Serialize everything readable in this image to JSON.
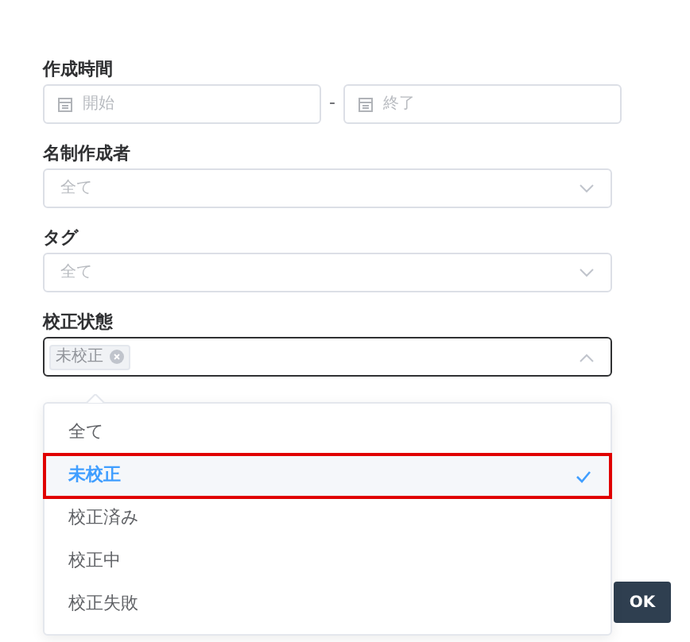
{
  "created_time": {
    "label": "作成時間",
    "start": {
      "placeholder": "開始"
    },
    "separator": "-",
    "end": {
      "placeholder": "終了"
    }
  },
  "card_creator": {
    "label": "名制作成者",
    "placeholder": "全て",
    "expanded": false
  },
  "tag": {
    "label": "タグ",
    "placeholder": "全て",
    "expanded": false
  },
  "calibration_status": {
    "label": "校正状態",
    "expanded": true,
    "chips": [
      {
        "label": "未校正"
      }
    ],
    "options": [
      {
        "label": "全て",
        "selected": false,
        "highlighted": false
      },
      {
        "label": "未校正",
        "selected": true,
        "highlighted": true
      },
      {
        "label": "校正済み",
        "selected": false,
        "highlighted": false
      },
      {
        "label": "校正中",
        "selected": false,
        "highlighted": false
      },
      {
        "label": "校正失敗",
        "selected": false,
        "highlighted": false
      }
    ]
  },
  "ok_button": "OK"
}
